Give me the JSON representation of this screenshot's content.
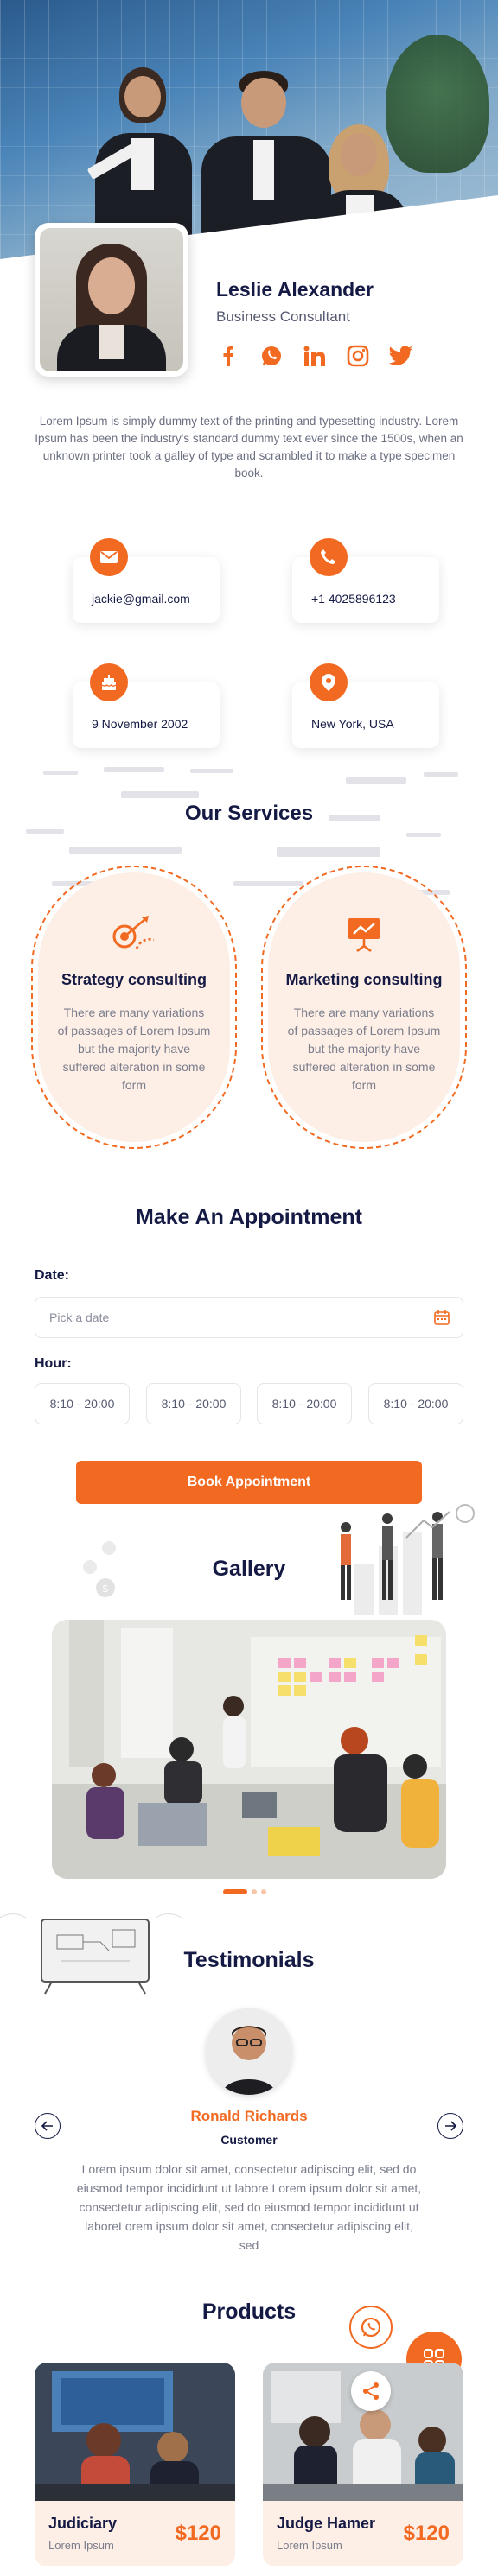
{
  "profile": {
    "name": "Leslie Alexander",
    "role": "Business Consultant",
    "bio": "Lorem Ipsum is simply dummy text of the printing and typesetting industry. Lorem Ipsum has been the industry's standard dummy text ever since the 1500s, when an unknown printer took a galley of type and scrambled it to make a type specimen book.",
    "socials": [
      "facebook-icon",
      "whatsapp-icon",
      "linkedin-icon",
      "instagram-icon",
      "twitter-icon"
    ]
  },
  "contacts": {
    "email": "jackie@gmail.com",
    "phone": "+1 4025896123",
    "birthday": "9 November 2002",
    "location": "New York, USA"
  },
  "services": {
    "title": "Our Services",
    "items": [
      {
        "title": "Strategy consulting",
        "desc": "There are many variations of passages of Lorem Ipsum but the majority have suffered alteration in some form"
      },
      {
        "title": "Marketing consulting",
        "desc": "There are many variations of passages of Lorem Ipsum but the majority have suffered alteration in some form"
      }
    ]
  },
  "appointment": {
    "title": "Make An Appointment",
    "date_label": "Date:",
    "date_placeholder": "Pick a date",
    "hour_label": "Hour:",
    "hours": [
      "8:10 - 20:00",
      "8:10 - 20:00",
      "8:10 - 20:00",
      "8:10 - 20:00"
    ],
    "button": "Book Appointment"
  },
  "gallery": {
    "title": "Gallery",
    "active_slide": 1,
    "slide_count": 3
  },
  "testimonials": {
    "title": "Testimonials",
    "name": "Ronald Richards",
    "role": "Customer",
    "quote": "Lorem ipsum dolor sit amet, consectetur adipiscing elit, sed do eiusmod tempor incididunt ut labore Lorem ipsum dolor sit amet, consectetur adipiscing elit, sed do eiusmod tempor incididunt ut laboreLorem ipsum dolor sit amet, consectetur adipiscing elit, sed"
  },
  "products": {
    "title": "Products",
    "items": [
      {
        "name": "Judiciary",
        "sub": "Lorem Ipsum",
        "price": "$120"
      },
      {
        "name": "Judge Hamer",
        "sub": "Lorem Ipsum",
        "price": "$120"
      }
    ]
  },
  "colors": {
    "accent": "#f26a21",
    "navy": "#151a45",
    "soft": "#fdeee6"
  }
}
